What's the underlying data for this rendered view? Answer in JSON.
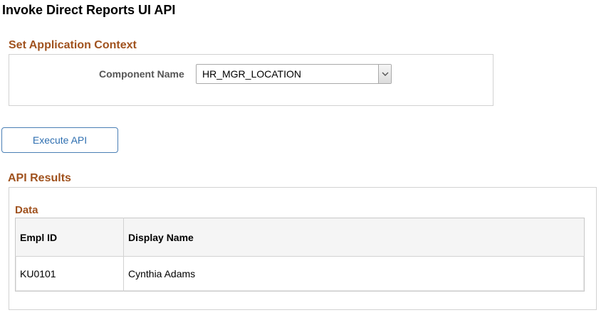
{
  "page": {
    "title": "Invoke Direct Reports UI API"
  },
  "context": {
    "section_title": "Set Application Context",
    "component_label": "Component Name",
    "component_value": "HR_MGR_LOCATION"
  },
  "actions": {
    "execute_label": "Execute API"
  },
  "results": {
    "section_title": "API Results",
    "grid_title": "Data",
    "columns": [
      "Empl ID",
      "Display Name"
    ],
    "rows": [
      {
        "empl_id": "KU0101",
        "display_name": "Cynthia Adams"
      }
    ]
  },
  "colors": {
    "section_title": "#a0521e",
    "button_text": "#2f6fb0",
    "button_border": "#4a7fb5"
  },
  "icons": {
    "dropdown": "chevron-down-icon"
  }
}
